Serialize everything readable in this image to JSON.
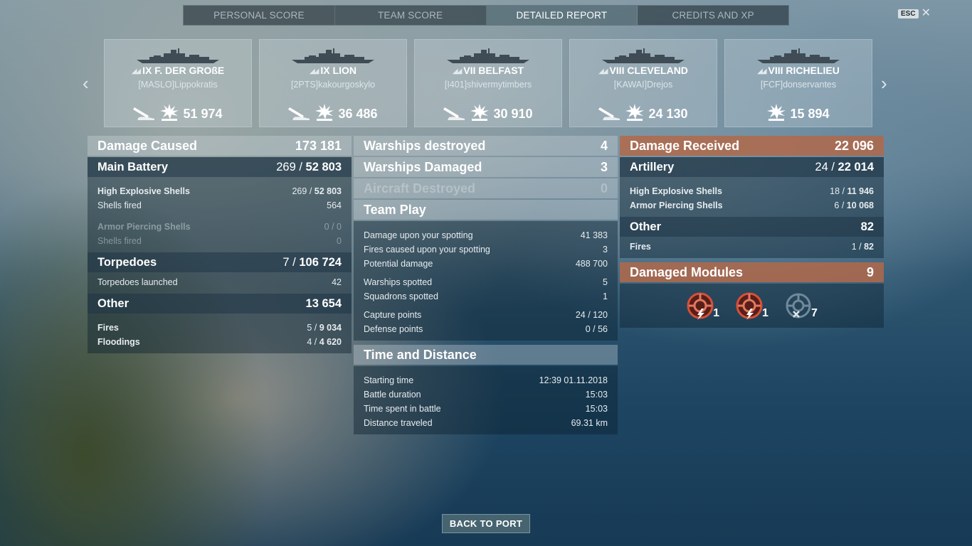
{
  "tabs": [
    {
      "label": "PERSONAL SCORE",
      "active": false
    },
    {
      "label": "TEAM SCORE",
      "active": false
    },
    {
      "label": "DETAILED REPORT",
      "active": true
    },
    {
      "label": "CREDITS AND XP",
      "active": false
    }
  ],
  "esc": {
    "key": "ESC",
    "close": "✕"
  },
  "nav": {
    "prev": "‹",
    "next": "›"
  },
  "cards": [
    {
      "ship": "IX F. DER GROßE",
      "player": "[MASLO]Lippokratis",
      "score": "51 974",
      "icons": [
        "torpedo-hit-icon",
        "explosion-icon"
      ]
    },
    {
      "ship": "IX LION",
      "player": "[2PTS]kakourgoskylo",
      "score": "36 486",
      "icons": [
        "torpedo-hit-icon",
        "explosion-icon"
      ]
    },
    {
      "ship": "VII BELFAST",
      "player": "[I401]shivermytimbers",
      "score": "30 910",
      "icons": [
        "torpedo-hit-icon",
        "explosion-icon"
      ]
    },
    {
      "ship": "VIII CLEVELAND",
      "player": "[KAWAI]Drejos",
      "score": "24 130",
      "icons": [
        "torpedo-hit-icon",
        "explosion-icon"
      ]
    },
    {
      "ship": "VIII RICHELIEU",
      "player": "[FCF]donservantes",
      "score": "15 894",
      "icons": [
        "explosion-icon"
      ]
    }
  ],
  "left": {
    "damage_caused": {
      "label": "Damage Caused",
      "value": "173 181"
    },
    "main_battery": {
      "label": "Main Battery",
      "hits": "269 / ",
      "value": "52 803"
    },
    "he": {
      "label": "High Explosive Shells",
      "hits": "269 / ",
      "value": "52 803"
    },
    "he_fired": {
      "label": "Shells fired",
      "value": "564"
    },
    "ap": {
      "label": "Armor Piercing Shells",
      "value": "0 / 0"
    },
    "ap_fired": {
      "label": "Shells fired",
      "value": "0"
    },
    "torpedoes": {
      "label": "Torpedoes",
      "hits": "7 / ",
      "value": "106 724"
    },
    "torp_launched": {
      "label": "Torpedoes launched",
      "value": "42"
    },
    "other": {
      "label": "Other",
      "value": "13 654"
    },
    "fires": {
      "label": "Fires",
      "hits": "5 / ",
      "value": "9 034"
    },
    "floodings": {
      "label": "Floodings",
      "hits": "4 / ",
      "value": "4 620"
    }
  },
  "middle": {
    "warships_destroyed": {
      "label": "Warships destroyed",
      "value": "4"
    },
    "warships_damaged": {
      "label": "Warships Damaged",
      "value": "3"
    },
    "aircraft_destroyed": {
      "label": "Aircraft Destroyed",
      "value": "0"
    },
    "team_play": {
      "label": "Team Play"
    },
    "team_rows": [
      {
        "label": "Damage upon your spotting",
        "value": "41 383"
      },
      {
        "label": "Fires caused upon your spotting",
        "value": "3"
      },
      {
        "label": "Potential damage",
        "value": "488 700"
      },
      {
        "label": "Warships spotted",
        "value": "5"
      },
      {
        "label": "Squadrons spotted",
        "value": "1"
      },
      {
        "label": "Capture points",
        "value": "24 / 120"
      },
      {
        "label": "Defense points",
        "value": "0 / 56"
      }
    ],
    "time_distance": {
      "label": "Time and Distance"
    },
    "time_rows": [
      {
        "label": "Starting time",
        "value": "12:39  01.11.2018"
      },
      {
        "label": "Battle duration",
        "value": "15:03"
      },
      {
        "label": "Time spent in battle",
        "value": "15:03"
      },
      {
        "label": "Distance traveled",
        "value": "69.31 km"
      }
    ]
  },
  "right": {
    "damage_received": {
      "label": "Damage Received",
      "value": "22 096"
    },
    "artillery": {
      "label": "Artillery",
      "hits": "24 / ",
      "value": "22 014"
    },
    "he": {
      "label": "High Explosive Shells",
      "hits": "18 / ",
      "value": "11 946"
    },
    "ap": {
      "label": "Armor Piercing Shells",
      "hits": "6 / ",
      "value": "10 068"
    },
    "other": {
      "label": "Other",
      "value": "82"
    },
    "fires": {
      "label": "Fires",
      "hits": "1 / ",
      "value": "82"
    },
    "damaged_modules": {
      "label": "Damaged Modules",
      "value": "9"
    },
    "modules": [
      {
        "icon": "module-damaged-icon",
        "count": "1"
      },
      {
        "icon": "module-damaged-icon",
        "count": "1"
      },
      {
        "icon": "module-destroyed-icon",
        "count": "7"
      }
    ]
  },
  "back_button": "BACK TO PORT",
  "colors": {
    "accent_orange": "#b2684a",
    "panel_dark": "#182e3e",
    "button": "#466470"
  }
}
